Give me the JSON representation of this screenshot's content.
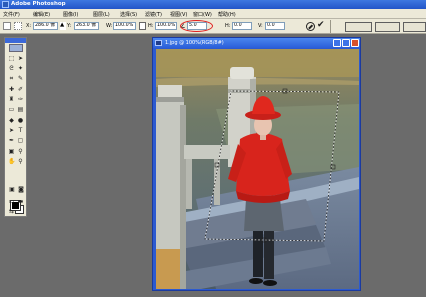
{
  "app": {
    "title": "Adobe Photoshop"
  },
  "menu": [
    "文件(F)",
    "编辑(E)",
    "图像(I)",
    "图层(L)",
    "选择(S)",
    "滤镜(T)",
    "视图(V)",
    "窗口(W)",
    "帮助(H)"
  ],
  "options": {
    "x_label": "X:",
    "x_value": "286.0 像",
    "y_label": "Y:",
    "y_value": "263.0 像",
    "w_label": "W:",
    "w_value": "100.0%",
    "h_label": "H:",
    "h_value": "100.0%",
    "angle_value": "5.0",
    "hskew_label": "H:",
    "hskew_value": "0.0",
    "vskew_label": "V:",
    "vskew_value": "0.0"
  },
  "document": {
    "title": "1.jpg @ 100%(RGB/8#)"
  },
  "colors": {
    "accent_blue": "#2c5ad0",
    "highlight_red": "#e02020",
    "jacket_red": "#d8241c"
  }
}
